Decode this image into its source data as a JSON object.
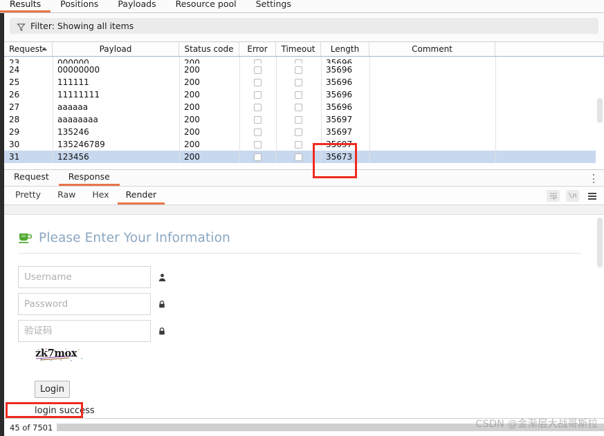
{
  "top_tabs": [
    {
      "label": "Results",
      "active": true
    },
    {
      "label": "Positions",
      "active": false
    },
    {
      "label": "Payloads",
      "active": false
    },
    {
      "label": "Resource pool",
      "active": false
    },
    {
      "label": "Settings",
      "active": false
    }
  ],
  "filter": {
    "icon": "filter-funnel-icon",
    "label": "Filter: Showing all items"
  },
  "results_table": {
    "columns": [
      "Request",
      "Payload",
      "Status code",
      "Error",
      "Timeout",
      "Length",
      "Comment"
    ],
    "sort_column": "Request",
    "sort_direction": "asc",
    "rows": [
      {
        "request": "23",
        "payload": "000000",
        "status": "200",
        "error": false,
        "timeout": false,
        "length": "35696",
        "comment": "",
        "selected": false,
        "clipped": true
      },
      {
        "request": "24",
        "payload": "00000000",
        "status": "200",
        "error": false,
        "timeout": false,
        "length": "35696",
        "comment": "",
        "selected": false,
        "clipped": false
      },
      {
        "request": "25",
        "payload": "111111",
        "status": "200",
        "error": false,
        "timeout": false,
        "length": "35696",
        "comment": "",
        "selected": false,
        "clipped": false
      },
      {
        "request": "26",
        "payload": "11111111",
        "status": "200",
        "error": false,
        "timeout": false,
        "length": "35696",
        "comment": "",
        "selected": false,
        "clipped": false
      },
      {
        "request": "27",
        "payload": "aaaaaa",
        "status": "200",
        "error": false,
        "timeout": false,
        "length": "35696",
        "comment": "",
        "selected": false,
        "clipped": false
      },
      {
        "request": "28",
        "payload": "aaaaaaaa",
        "status": "200",
        "error": false,
        "timeout": false,
        "length": "35697",
        "comment": "",
        "selected": false,
        "clipped": false
      },
      {
        "request": "29",
        "payload": "135246",
        "status": "200",
        "error": false,
        "timeout": false,
        "length": "35697",
        "comment": "",
        "selected": false,
        "clipped": false
      },
      {
        "request": "30",
        "payload": "135246789",
        "status": "200",
        "error": false,
        "timeout": false,
        "length": "35697",
        "comment": "",
        "selected": false,
        "clipped": false
      },
      {
        "request": "31",
        "payload": "123456",
        "status": "200",
        "error": false,
        "timeout": false,
        "length": "35673",
        "comment": "",
        "selected": true,
        "clipped": false
      }
    ]
  },
  "message_tabs": [
    {
      "label": "Request",
      "active": false
    },
    {
      "label": "Response",
      "active": true
    }
  ],
  "view_tabs": [
    {
      "label": "Pretty",
      "active": false
    },
    {
      "label": "Raw",
      "active": false
    },
    {
      "label": "Hex",
      "active": false
    },
    {
      "label": "Render",
      "active": true
    }
  ],
  "view_tools": [
    {
      "name": "word-wrap-icon",
      "glyph": "↵"
    },
    {
      "name": "newline-icon",
      "glyph": "\\n"
    },
    {
      "name": "hamburger-menu-icon",
      "glyph": "☰"
    }
  ],
  "kebab": {
    "name": "more-options-icon"
  },
  "rendered_page": {
    "logo_icon": "coffee-cup-icon",
    "heading": "Please Enter Your Information",
    "fields": [
      {
        "name": "username",
        "placeholder": "Username",
        "value": "",
        "icon": "user-icon",
        "type": "text"
      },
      {
        "name": "password",
        "placeholder": "Password",
        "value": "",
        "icon": "lock-icon",
        "type": "password"
      },
      {
        "name": "captcha",
        "placeholder": "验证码",
        "value": "",
        "icon": "lock-icon",
        "type": "text"
      }
    ],
    "captcha_image_text": "zk7mox",
    "login_button": "Login",
    "status_message": "login success"
  },
  "status_bar": {
    "progress_text": "45 of 7501"
  },
  "watermark": "CSDN @金渐层大战哥斯拉",
  "colors": {
    "accent": "#e8744a",
    "annotation": "#ef2a1e",
    "row_selected": "#c8d8ee",
    "heading": "#8aa6c2",
    "cup_green": "#4ea72e"
  }
}
